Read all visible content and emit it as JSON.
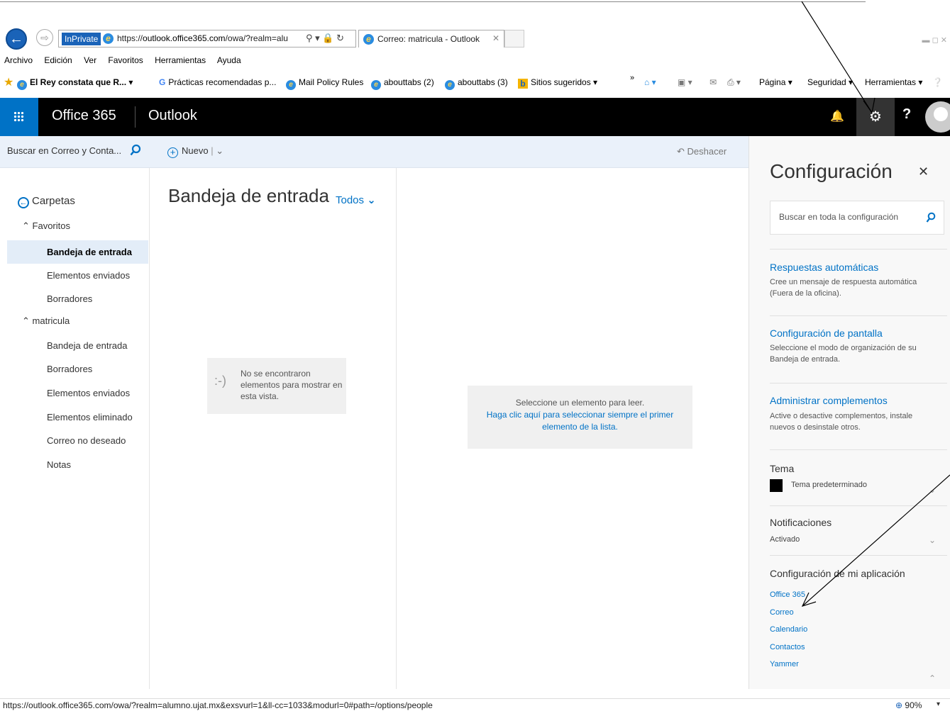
{
  "browser": {
    "inprivate": "InPrivate",
    "url_prefix": "https://",
    "url_host": "outlook.office365.com",
    "url_rest": "/owa/?realm=alu",
    "tab_title": "Correo: matricula - Outlook",
    "menu": [
      "Archivo",
      "Edición",
      "Ver",
      "Favoritos",
      "Herramientas",
      "Ayuda"
    ],
    "favorites": [
      {
        "label": "El Rey constata que R... ▾",
        "icon": "ie-icon"
      },
      {
        "label": "Prácticas recomendadas p...",
        "icon": "google-icon"
      },
      {
        "label": "Mail Policy Rules",
        "icon": "ie-icon"
      },
      {
        "label": "abouttabs (2)",
        "icon": "ie-icon"
      },
      {
        "label": "abouttabs (3)",
        "icon": "ie-icon"
      },
      {
        "label": "Sitios sugeridos ▾",
        "icon": "bing-icon"
      }
    ],
    "commands": [
      "Página ▾",
      "Seguridad ▾",
      "Herramientas ▾"
    ],
    "status_url": "https://outlook.office365.com/owa/?realm=alumno.ujat.mx&exsvurl=1&ll-cc=1033&modurl=0#path=/options/people",
    "zoom": "90%"
  },
  "header": {
    "brand": "Office 365",
    "app": "Outlook"
  },
  "commandbar": {
    "search_placeholder": "Buscar en Correo y Conta...",
    "new_label": "Nuevo",
    "undo_label": "Deshacer"
  },
  "folders": {
    "header": "Carpetas",
    "favorites_label": "Favoritos",
    "favorites": [
      "Bandeja de entrada",
      "Elementos enviados",
      "Borradores"
    ],
    "account_label": "matricula",
    "account_items": [
      "Bandeja de entrada",
      "Borradores",
      "Elementos enviados",
      "Elementos eliminado",
      "Correo no deseado",
      "Notas"
    ]
  },
  "messagelist": {
    "title": "Bandeja de entrada",
    "filter": "Todos",
    "empty_face": ":-)",
    "empty_text": "No se encontraron elementos para mostrar en esta vista."
  },
  "reading": {
    "line1": "Seleccione un elemento para leer.",
    "link": "Haga clic aquí para seleccionar siempre el primer elemento de la lista."
  },
  "settings": {
    "title": "Configuración",
    "search_placeholder": "Buscar en toda la configuración",
    "auto_reply": {
      "title": "Respuestas automáticas",
      "desc": "Cree un mensaje de respuesta automática (Fuera de la oficina)."
    },
    "display": {
      "title": "Configuración de pantalla",
      "desc": "Seleccione el modo de organización de su Bandeja de entrada."
    },
    "addins": {
      "title": "Administrar complementos",
      "desc": "Active o desactive complementos, instale nuevos o desinstale otros."
    },
    "theme": {
      "title": "Tema",
      "value": "Tema predeterminado"
    },
    "notifications": {
      "title": "Notificaciones",
      "value": "Activado"
    },
    "app_settings": {
      "title": "Configuración de mi aplicación",
      "links": [
        "Office 365",
        "Correo",
        "Calendario",
        "Contactos",
        "Yammer"
      ]
    }
  },
  "colors": {
    "accent": "#0072c6",
    "header_bg": "#000000",
    "selected_folder_bg": "#e3edf8",
    "panel_bg": "#f8f8f8"
  }
}
